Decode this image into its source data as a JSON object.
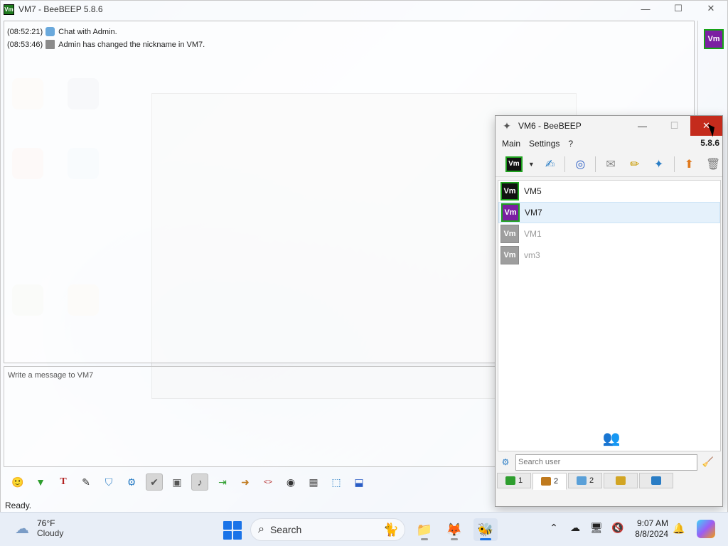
{
  "main_window": {
    "title": "VM7 - BeeBEEP 5.8.6",
    "app_icon_text": "Vm",
    "controls": {
      "minimize": "—",
      "maximize": "☐",
      "close": "✕"
    },
    "chat_lines": [
      {
        "time": "(08:52:21)",
        "icon": "chat-bubble-icon",
        "text": "Chat with Admin."
      },
      {
        "time": "(08:53:46)",
        "icon": "info-note-icon",
        "text": "Admin has changed the nickname in VM7."
      }
    ],
    "compose_placeholder": "Write a message to VM7",
    "status": "Ready.",
    "right_avatar_text": "Vm"
  },
  "compose_toolbar": [
    {
      "name": "emoji-icon",
      "glyph": "🙂"
    },
    {
      "name": "send-file-icon",
      "glyph": "▼"
    },
    {
      "name": "font-icon",
      "glyph": "T"
    },
    {
      "name": "magic-wand-icon",
      "glyph": "✎"
    },
    {
      "name": "filter-icon",
      "glyph": "⛉"
    },
    {
      "name": "settings-gear-icon",
      "glyph": "⚙"
    },
    {
      "name": "check-list-icon",
      "glyph": "✔"
    },
    {
      "name": "screenshot-icon",
      "glyph": "▣"
    },
    {
      "name": "note-icon",
      "glyph": "♪"
    },
    {
      "name": "export-icon",
      "glyph": "⇥"
    },
    {
      "name": "forward-icon",
      "glyph": "➜"
    },
    {
      "name": "code-icon",
      "glyph": "<>"
    },
    {
      "name": "camera-icon",
      "glyph": "◉"
    },
    {
      "name": "calculator-icon",
      "glyph": "▦"
    },
    {
      "name": "attach-icon",
      "glyph": "⬚"
    },
    {
      "name": "save-icon",
      "glyph": "⬓"
    }
  ],
  "vm6": {
    "title": "VM6 - BeeBEEP",
    "menu": [
      "Main",
      "Settings",
      "?"
    ],
    "version": "5.8.6",
    "status_avatar_text": "Vm",
    "toolbar": [
      {
        "name": "edit-profile-icon",
        "glyph": "✍"
      },
      {
        "name": "network-icon",
        "glyph": "◎"
      },
      {
        "name": "mail-icon",
        "glyph": "✉"
      },
      {
        "name": "pencil-icon",
        "glyph": "✏"
      },
      {
        "name": "tools-icon",
        "glyph": "✦"
      },
      {
        "name": "share-icon",
        "glyph": "⬆"
      },
      {
        "name": "trash-icon",
        "glyph": "🗑"
      }
    ],
    "users": [
      {
        "name": "VM5",
        "avatar_text": "Vm",
        "status": "online",
        "selected": false
      },
      {
        "name": "VM7",
        "avatar_text": "Vm",
        "status": "online",
        "selected": true
      },
      {
        "name": "VM1",
        "avatar_text": "Vm",
        "status": "offline",
        "selected": false
      },
      {
        "name": "vm3",
        "avatar_text": "Vm",
        "status": "offline",
        "selected": false
      }
    ],
    "search_placeholder": "Search user",
    "tabs": [
      {
        "name": "chats-tab",
        "count": "1",
        "color": "#2e9e2e"
      },
      {
        "name": "users-tab",
        "count": "2",
        "color": "#c07a1e"
      },
      {
        "name": "groups-tab",
        "count": "2",
        "color": "#5aa0d8"
      },
      {
        "name": "shared-tab",
        "count": "",
        "color": "#d2a524"
      },
      {
        "name": "plugins-tab",
        "count": "",
        "color": "#2a7dc5"
      }
    ]
  },
  "taskbar": {
    "weather_temp": "76°F",
    "weather_cond": "Cloudy",
    "search_label": "Search",
    "time": "9:07 AM",
    "date": "8/8/2024",
    "apps": [
      {
        "name": "file-explorer-icon",
        "glyph": "📁"
      },
      {
        "name": "firefox-icon",
        "glyph": "🦊"
      },
      {
        "name": "beebeep-taskbar-icon",
        "glyph": "🐝"
      }
    ],
    "tray": [
      {
        "name": "chevron-up-icon",
        "glyph": "⌃"
      },
      {
        "name": "onedrive-icon",
        "glyph": "☁"
      },
      {
        "name": "network-display-icon",
        "glyph": "🖥"
      },
      {
        "name": "volume-mute-icon",
        "glyph": "🔇"
      }
    ]
  }
}
